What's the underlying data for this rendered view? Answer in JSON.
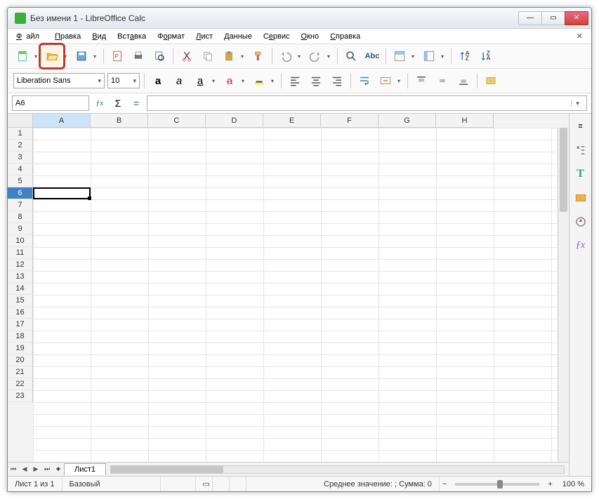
{
  "window": {
    "title": "Без имени 1 - LibreOffice Calc"
  },
  "menu": {
    "file": "Файл",
    "edit": "Правка",
    "view": "Вид",
    "insert": "Вставка",
    "format": "Формат",
    "sheet": "Лист",
    "data": "Данные",
    "tools": "Сервис",
    "window": "Окно",
    "help": "Справка"
  },
  "format_bar": {
    "font_name": "Liberation Sans",
    "font_size": "10"
  },
  "formula": {
    "cell_ref": "A6",
    "value": ""
  },
  "columns": [
    "A",
    "B",
    "C",
    "D",
    "E",
    "F",
    "G",
    "H"
  ],
  "rows": [
    "1",
    "2",
    "3",
    "4",
    "5",
    "6",
    "7",
    "8",
    "9",
    "10",
    "11",
    "12",
    "13",
    "14",
    "15",
    "16",
    "17",
    "18",
    "19",
    "20",
    "21",
    "22",
    "23"
  ],
  "selected": {
    "col": "A",
    "row": "6"
  },
  "sheet_tab": "Лист1",
  "status": {
    "sheet_pos": "Лист 1 из 1",
    "style": "Базовый",
    "aggregate": "Среднее значение: ; Сумма: 0",
    "zoom": "100 %"
  },
  "icons": {
    "bold": "a",
    "italic": "a",
    "underline": "a",
    "strike": "a",
    "sigma": "Σ",
    "equals": "=",
    "fx": "ƒx",
    "abc": "Abc"
  }
}
